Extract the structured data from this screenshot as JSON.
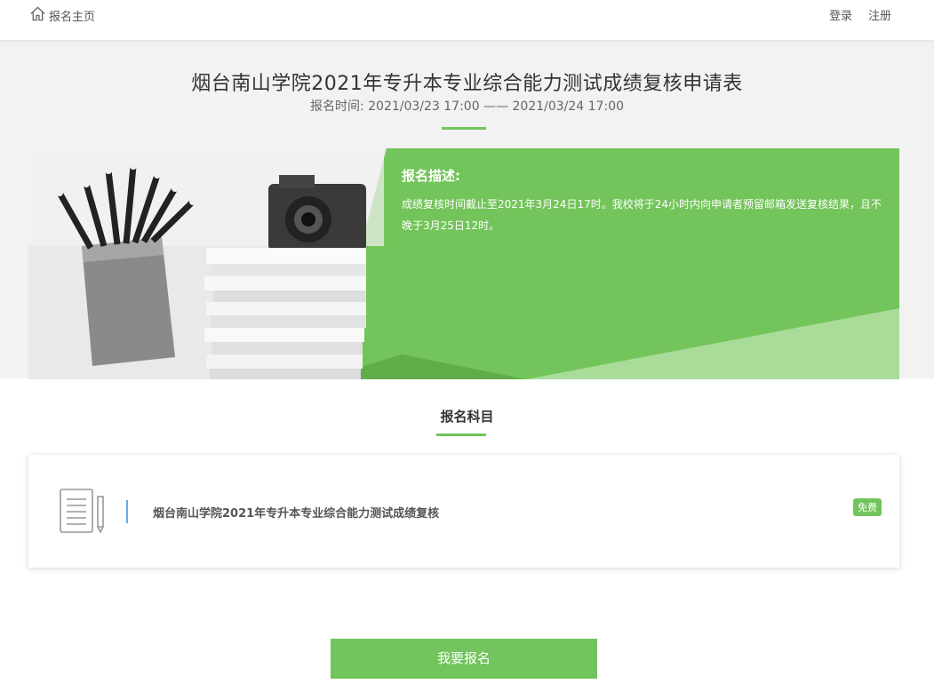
{
  "nav": {
    "home_label": "报名主页",
    "login_label": "登录",
    "register_label": "注册"
  },
  "hero": {
    "title": "烟台南山学院2021年专升本专业综合能力测试成绩复核申请表",
    "period": "报名时间: 2021/03/23 17:00 —— 2021/03/24 17:00"
  },
  "banner": {
    "heading": "报名描述:",
    "description": "成绩复核时间截止至2021年3月24日17时。我校将于24小时内向申请者预留邮箱发送复核结果，且不晚于3月25日12时。"
  },
  "subjects": {
    "section_title": "报名科目",
    "items": [
      {
        "title": "烟台南山学院2021年专升本专业综合能力测试成绩复核",
        "badge": "免费"
      }
    ]
  },
  "cta_label": "我要报名",
  "colors": {
    "accent": "#72c45c",
    "bar": "#6aaae8",
    "hero_bg": "#f2f2f2"
  },
  "icons": [
    "home-icon",
    "document-icon",
    "pencil-icon"
  ]
}
